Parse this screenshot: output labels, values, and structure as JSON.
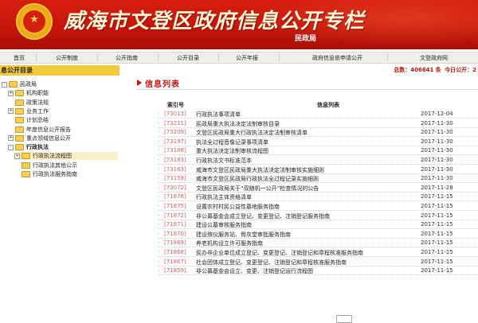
{
  "header": {
    "title": "威海市文登区政府信息公开专栏",
    "department": "民政局"
  },
  "nav": [
    "首页",
    "公开制度",
    "公开指南",
    "公开目录",
    "公开年报",
    "政府信息依申请公开",
    "文登政府网"
  ],
  "sidebar": {
    "heading": "息公开目录",
    "items": [
      {
        "label": "民政局",
        "level": 0,
        "expander": "-"
      },
      {
        "label": "机构职能",
        "level": 1,
        "expander": "+"
      },
      {
        "label": "政策法规",
        "level": 1,
        "expander": ""
      },
      {
        "label": "业务工作",
        "level": 1,
        "expander": "+"
      },
      {
        "label": "计划总结",
        "level": 1,
        "expander": ""
      },
      {
        "label": "年度信息公开报告",
        "level": 1,
        "expander": ""
      },
      {
        "label": "重点领域信息公开",
        "level": 1,
        "expander": "+"
      },
      {
        "label": "行政执法",
        "level": 1,
        "expander": "-",
        "bold": true
      },
      {
        "label": "行政执法流程图",
        "level": 2,
        "expander": "+",
        "selected": true
      },
      {
        "label": "行政执法其他公示",
        "level": 2,
        "expander": ""
      },
      {
        "label": "行政执法服务指南",
        "level": 2,
        "expander": ""
      }
    ]
  },
  "stats": {
    "total_label": "总数：",
    "total": "406641",
    "unit": "条",
    "today_label": "今日公开：",
    "today": "2"
  },
  "list": {
    "title": "信息列表",
    "col_index": "索引号",
    "col_list": "信息列表",
    "rows": [
      {
        "code": "[73013]",
        "title": "行政执法事项清单",
        "date": "2017-12-04"
      },
      {
        "code": "[73211]",
        "title": "民政局重大执法决定法制审核目录",
        "date": "2017-11-30"
      },
      {
        "code": "[73209]",
        "title": "文登区民政局重大行政执法决定法制审核清单",
        "date": "2017-11-30"
      },
      {
        "code": "[73197]",
        "title": "执法全过程音像记录事项清单",
        "date": "2017-11-30"
      },
      {
        "code": "[73188]",
        "title": "重大执法决定法制审核流程图",
        "date": "2017-11-30"
      },
      {
        "code": "[73183]",
        "title": "行政执法文书标准范本",
        "date": "2017-11-30"
      },
      {
        "code": "[73163]",
        "title": "威海市文登区民政局重大执法决定法制审核实施细则",
        "date": "2017-11-30"
      },
      {
        "code": "[73159]",
        "title": "威海市文登区民政局行政执法全过程记录实施细则",
        "date": "2017-11-30"
      },
      {
        "code": "[73072]",
        "title": "文登区民政局关于“双随机一公开”检查情况的公告",
        "date": "2017-11-28"
      },
      {
        "code": "[71876]",
        "title": "行政执法主体资格清单",
        "date": "2017-11-15"
      },
      {
        "code": "[71875]",
        "title": "设置农村村民公益性墓地服务指南",
        "date": "2017-11-15"
      },
      {
        "code": "[71872]",
        "title": "非公募基金会成立登记、变更登记、注销登记服务指南",
        "date": "2017-11-15"
      },
      {
        "code": "[71871]",
        "title": "建设公墓审核服务指南",
        "date": "2017-11-15"
      },
      {
        "code": "[71870]",
        "title": "建设殡仪服务站、骨灰堂审批服务指南",
        "date": "2017-11-15"
      },
      {
        "code": "[71869]",
        "title": "养老机构设立许可服务指南",
        "date": "2017-11-15"
      },
      {
        "code": "[71868]",
        "title": "民办非企业单位成立登记、变更登记、注销登记和章程核准服务指南",
        "date": "2017-11-15"
      },
      {
        "code": "[71867]",
        "title": "社会团体成立登记、变更登记、注销登记和章程核准服务指南",
        "date": "2017-11-15"
      },
      {
        "code": "[71859]",
        "title": "非公募基金会设立、变更、注销登记运行流程图",
        "date": "2017-11-15"
      }
    ]
  },
  "colors": {
    "brand_red": "#c2140a",
    "banner_red": "#d81e12",
    "sidebar_head": "#f3c93e",
    "code_red": "#e06060"
  }
}
